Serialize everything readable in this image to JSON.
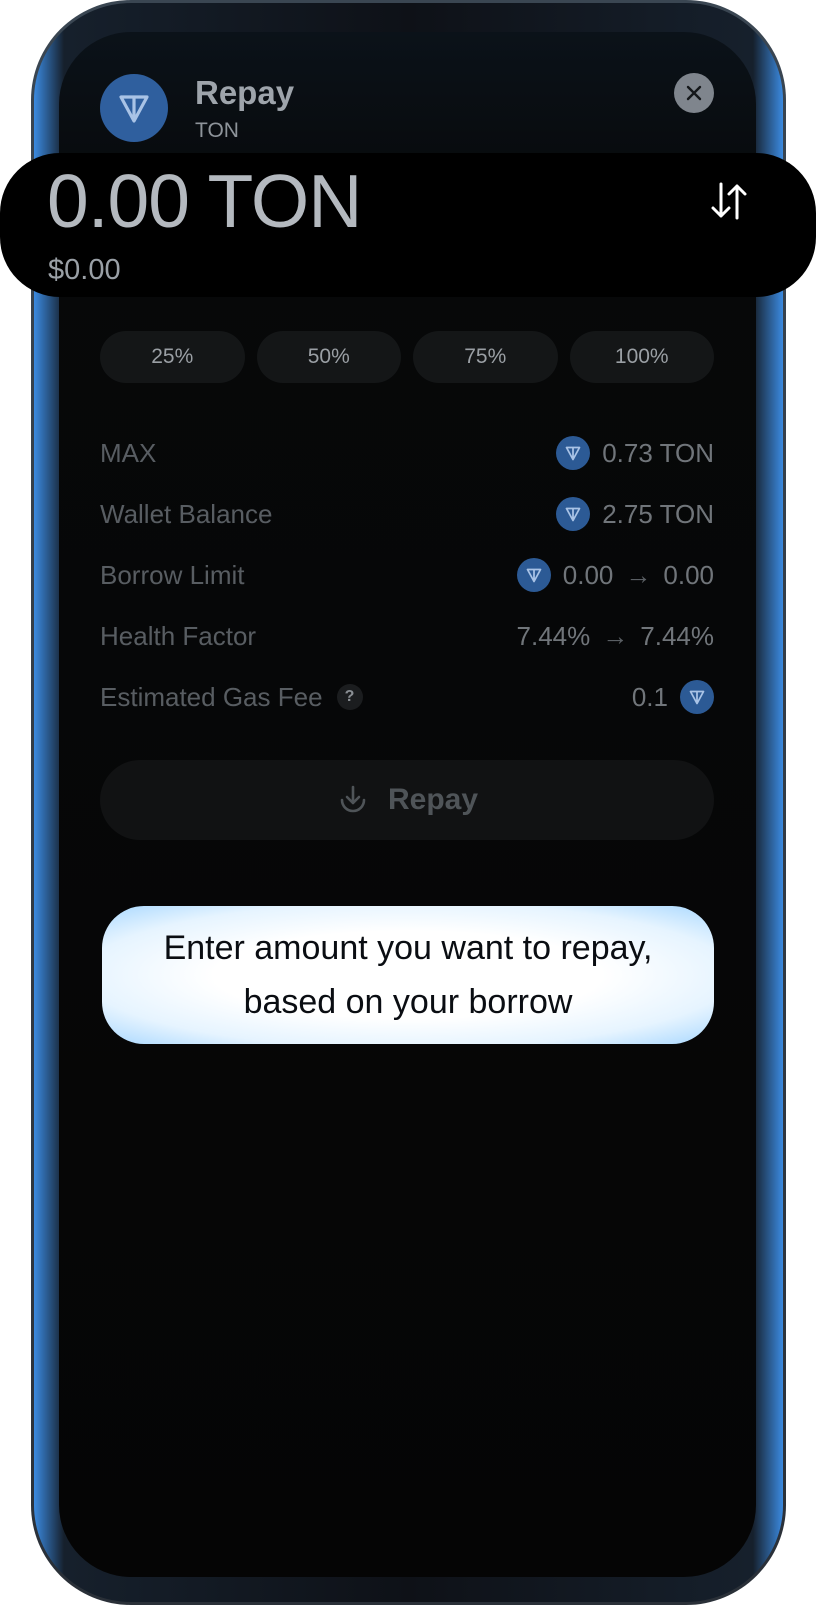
{
  "header": {
    "title": "Repay",
    "subtitle": "TON"
  },
  "amount": {
    "value": "0.00 TON",
    "usd": "$0.00"
  },
  "percent_chips": [
    "25%",
    "50%",
    "75%",
    "100%"
  ],
  "info": {
    "max": {
      "label": "MAX",
      "value": "0.73 TON"
    },
    "wallet_balance": {
      "label": "Wallet Balance",
      "value": "2.75 TON"
    },
    "borrow_limit": {
      "label": "Borrow Limit",
      "from": "0.00",
      "to": "0.00"
    },
    "health_factor": {
      "label": "Health Factor",
      "from": "7.44%",
      "to": "7.44%"
    },
    "gas_fee": {
      "label": "Estimated Gas Fee",
      "help": "?",
      "value": "0.1"
    },
    "arrow": "→"
  },
  "repay_button": {
    "label": "Repay"
  },
  "tooltip": {
    "text": "Enter amount you want to repay, based on your borrow"
  },
  "colors": {
    "ton_blue": "#2f5f9e",
    "tooltip_glow": "#a9d8ff",
    "background": "#050505"
  },
  "icons": [
    "ton-logo-icon",
    "close-icon",
    "swap-arrows-icon",
    "help-icon",
    "download-icon"
  ]
}
